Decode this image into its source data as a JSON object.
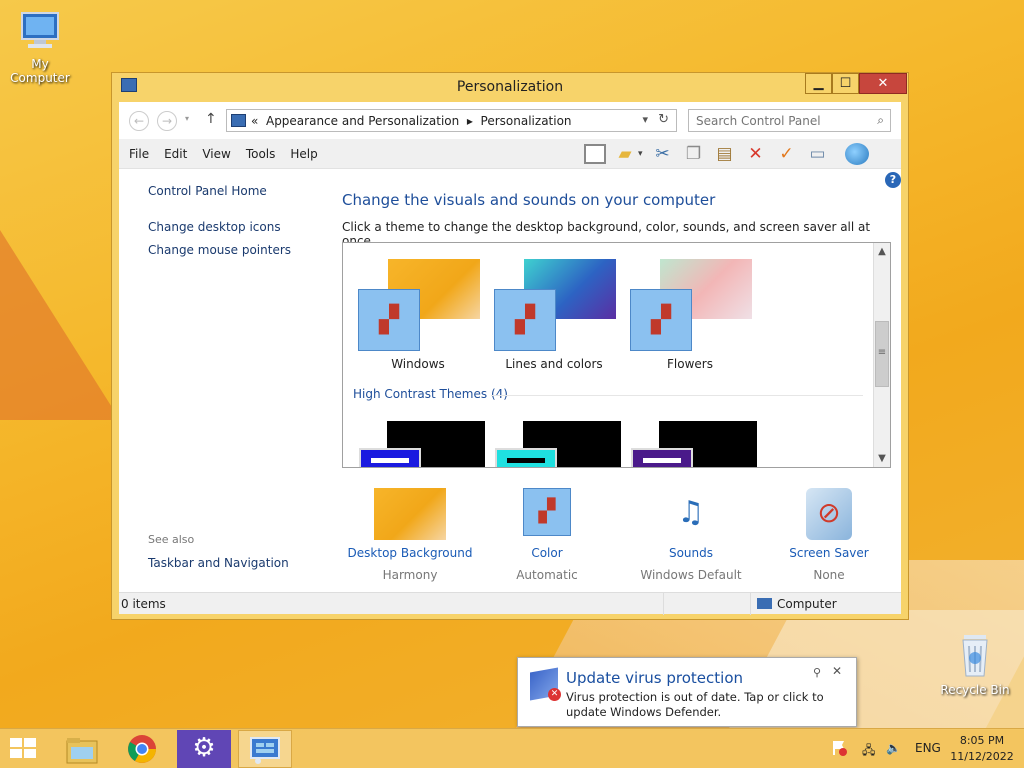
{
  "desktop": {
    "my_computer": "My Computer",
    "recycle_bin": "Recycle Bin"
  },
  "window": {
    "title": "Personalization",
    "controls": {
      "minimize": "▁",
      "maximize": "☐",
      "close": "✕"
    },
    "address": {
      "prefix": "«",
      "crumbs": [
        "Appearance and Personalization",
        "Personalization"
      ],
      "separator": "▸"
    },
    "search_placeholder": "Search Control Panel",
    "menu": [
      "File",
      "Edit",
      "View",
      "Tools",
      "Help"
    ],
    "left_pane": {
      "home": "Control Panel Home",
      "links": [
        "Change desktop icons",
        "Change mouse pointers"
      ],
      "see_also": "See also",
      "see_also_link": "Taskbar and Navigation"
    },
    "heading": "Change the visuals and sounds on your computer",
    "subheading": "Click a theme to change the desktop background, color, sounds, and screen saver all at once.",
    "themes": [
      {
        "name": "Windows"
      },
      {
        "name": "Lines and colors"
      },
      {
        "name": "Flowers"
      }
    ],
    "high_contrast_label": "High Contrast Themes (4)",
    "high_contrast_chip_colors": [
      "#1a1ae0",
      "#1fe0e0",
      "#4a1a8a"
    ],
    "settings": [
      {
        "label": "Desktop Background",
        "value": "Harmony"
      },
      {
        "label": "Color",
        "value": "Automatic"
      },
      {
        "label": "Sounds",
        "value": "Windows Default"
      },
      {
        "label": "Screen Saver",
        "value": "None"
      }
    ],
    "status": {
      "items": "0 items",
      "location": "Computer"
    }
  },
  "notification": {
    "title": "Update virus protection",
    "message": "Virus protection is out of date. Tap or click to update Windows Defender."
  },
  "taskbar": {
    "language": "ENG",
    "time": "8:05 PM",
    "date": "11/12/2022"
  },
  "colors": {
    "accent": "#1e4e9a",
    "link": "#1a5bb6",
    "close": "#c7463d"
  }
}
